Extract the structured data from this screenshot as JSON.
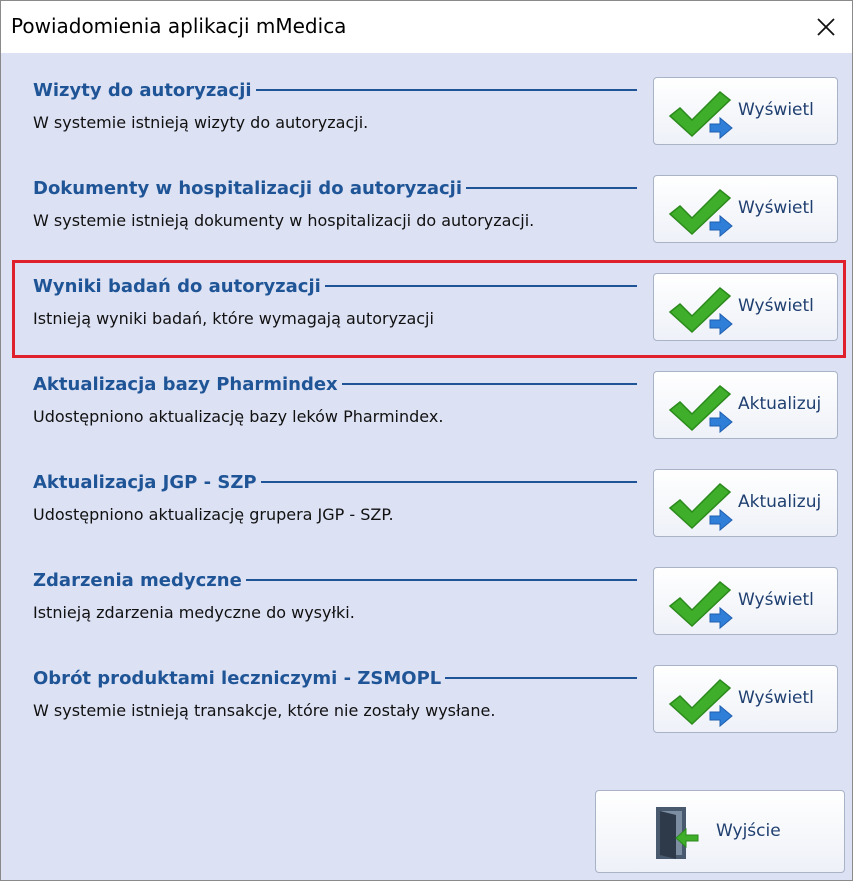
{
  "window": {
    "title": "Powiadomienia aplikacji mMedica",
    "close_label": "✕"
  },
  "notifications": [
    {
      "heading": "Wizyty do autoryzacji",
      "description": "W systemie istnieją wizyty do autoryzacji.",
      "button_label": "Wyświetl",
      "highlighted": false
    },
    {
      "heading": "Dokumenty w hospitalizacji do autoryzacji",
      "description": "W systemie istnieją dokumenty w hospitalizacji do autoryzacji.",
      "button_label": "Wyświetl",
      "highlighted": false
    },
    {
      "heading": "Wyniki badań do autoryzacji",
      "description": "Istnieją wyniki badań, które wymagają autoryzacji",
      "button_label": "Wyświetl",
      "highlighted": true
    },
    {
      "heading": "Aktualizacja bazy Pharmindex",
      "description": "Udostępniono aktualizację bazy leków Pharmindex.",
      "button_label": "Aktualizuj",
      "highlighted": false
    },
    {
      "heading": "Aktualizacja JGP - SZP",
      "description": "Udostępniono aktualizację grupera JGP - SZP.",
      "button_label": "Aktualizuj",
      "highlighted": false
    },
    {
      "heading": "Zdarzenia medyczne",
      "description": "Istnieją zdarzenia medyczne do wysyłki.",
      "button_label": "Wyświetl",
      "highlighted": false
    },
    {
      "heading": "Obrót produktami leczniczymi - ZSMOPL",
      "description": "W systemie istnieją transakcje, które nie zostały wysłane.",
      "button_label": "Wyświetl",
      "highlighted": false
    }
  ],
  "footer": {
    "exit_label": "Wyjście"
  },
  "icons": {
    "action": "checkmark-arrow-icon",
    "exit": "exit-door-icon"
  },
  "colors": {
    "heading": "#1f5596",
    "background": "#dce1f4",
    "highlight": "#e0202a",
    "check": "#3fae2a",
    "arrow": "#2f7fd8"
  }
}
